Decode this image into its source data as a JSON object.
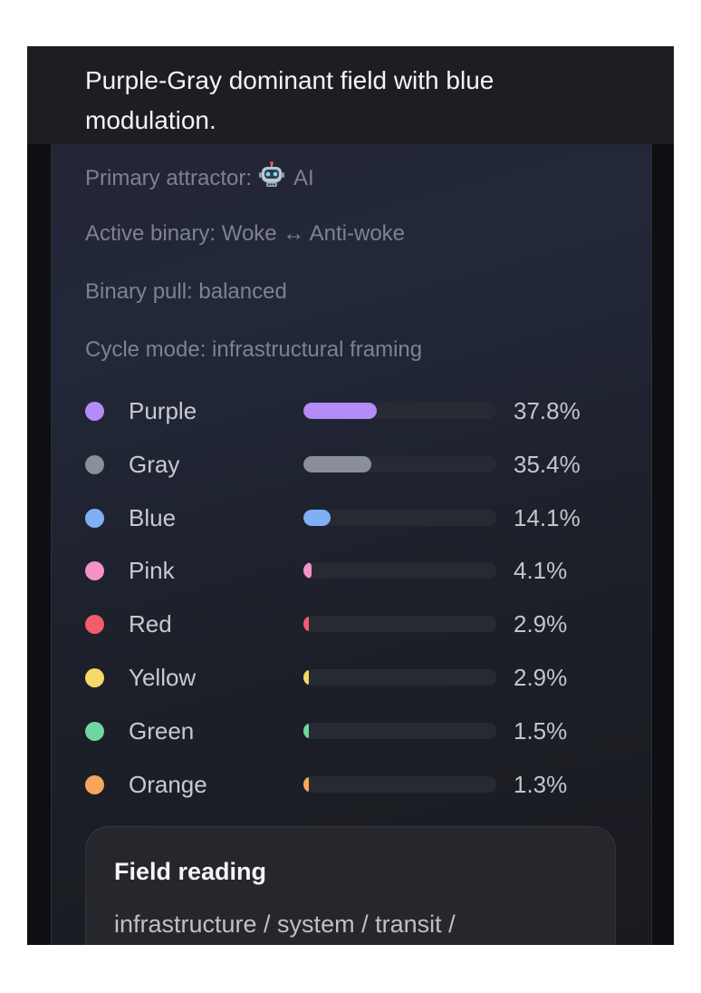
{
  "header": {
    "summary": "Purple-Gray dominant field with blue modulation."
  },
  "meta": {
    "primary_attractor_label": "Primary attractor:",
    "primary_attractor_icon": "robot-icon",
    "primary_attractor_value": "AI",
    "active_binary": "Active binary: Woke ↔ Anti-woke",
    "binary_pull": "Binary pull: balanced",
    "cycle_mode": "Cycle mode: infrastructural framing"
  },
  "colors": [
    {
      "name": "Purple",
      "percent": "37.8%",
      "value": 37.8,
      "color": "#b48cf6"
    },
    {
      "name": "Gray",
      "percent": "35.4%",
      "value": 35.4,
      "color": "#8a8f99"
    },
    {
      "name": "Blue",
      "percent": "14.1%",
      "value": 14.1,
      "color": "#7fb0f5"
    },
    {
      "name": "Pink",
      "percent": "4.1%",
      "value": 4.1,
      "color": "#f592c7"
    },
    {
      "name": "Red",
      "percent": "2.9%",
      "value": 2.9,
      "color": "#f35c6b"
    },
    {
      "name": "Yellow",
      "percent": "2.9%",
      "value": 2.9,
      "color": "#f4d86a"
    },
    {
      "name": "Green",
      "percent": "1.5%",
      "value": 1.5,
      "color": "#6fd79e"
    },
    {
      "name": "Orange",
      "percent": "1.3%",
      "value": 1.3,
      "color": "#f8a65e"
    }
  ],
  "field_reading": {
    "title": "Field reading",
    "body": "infrastructure / system / transit /"
  }
}
